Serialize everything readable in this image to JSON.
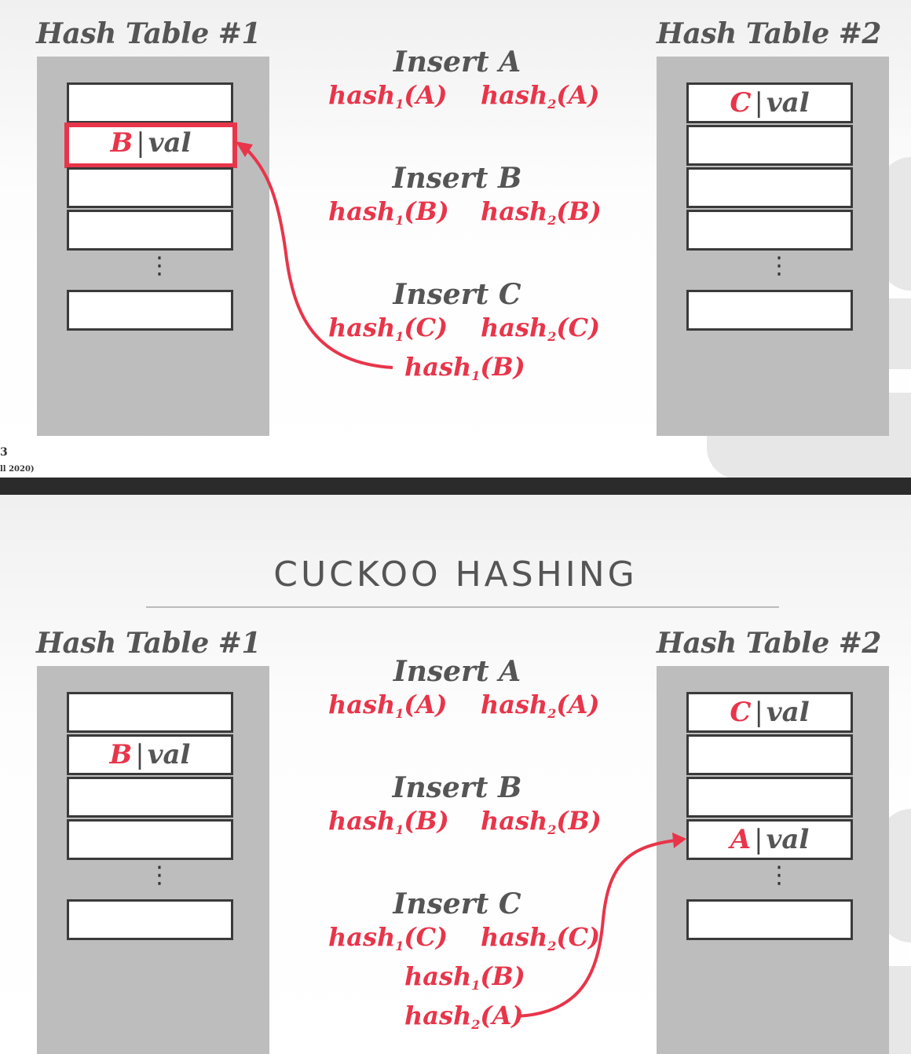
{
  "slide1": {
    "left_table": {
      "title": "Hash Table #1",
      "slots": [
        {
          "key": "",
          "val": ""
        },
        {
          "key": "B",
          "val": "val",
          "highlight": true
        },
        {
          "key": "",
          "val": ""
        },
        {
          "key": "",
          "val": ""
        },
        {
          "key": "",
          "val": ""
        }
      ]
    },
    "right_table": {
      "title": "Hash Table #2",
      "slots": [
        {
          "key": "C",
          "val": "val"
        },
        {
          "key": "",
          "val": ""
        },
        {
          "key": "",
          "val": ""
        },
        {
          "key": "",
          "val": ""
        },
        {
          "key": "",
          "val": ""
        }
      ]
    },
    "ops": [
      {
        "title": "Insert A",
        "calls": [
          {
            "fn": "hash",
            "n": "1",
            "arg": "(A)"
          },
          {
            "fn": "hash",
            "n": "2",
            "arg": "(A)"
          }
        ]
      },
      {
        "title": "Insert B",
        "calls": [
          {
            "fn": "hash",
            "n": "1",
            "arg": "(B)"
          },
          {
            "fn": "hash",
            "n": "2",
            "arg": "(B)"
          }
        ]
      },
      {
        "title": "Insert C",
        "calls": [
          {
            "fn": "hash",
            "n": "1",
            "arg": "(C)"
          },
          {
            "fn": "hash",
            "n": "2",
            "arg": "(C)"
          }
        ],
        "extra": [
          {
            "fn": "hash",
            "n": "1",
            "arg": "(B)"
          }
        ]
      }
    ],
    "footer": {
      "line1": "3",
      "line2": "ll 2020)"
    }
  },
  "slide2": {
    "title": "CUCKOO HASHING",
    "left_table": {
      "title": "Hash Table #1",
      "slots": [
        {
          "key": "",
          "val": ""
        },
        {
          "key": "B",
          "val": "val"
        },
        {
          "key": "",
          "val": ""
        },
        {
          "key": "",
          "val": ""
        },
        {
          "key": "",
          "val": ""
        }
      ]
    },
    "right_table": {
      "title": "Hash Table #2",
      "slots": [
        {
          "key": "C",
          "val": "val"
        },
        {
          "key": "",
          "val": ""
        },
        {
          "key": "",
          "val": ""
        },
        {
          "key": "A",
          "val": "val"
        },
        {
          "key": "",
          "val": ""
        }
      ]
    },
    "ops": [
      {
        "title": "Insert A",
        "calls": [
          {
            "fn": "hash",
            "n": "1",
            "arg": "(A)"
          },
          {
            "fn": "hash",
            "n": "2",
            "arg": "(A)"
          }
        ]
      },
      {
        "title": "Insert B",
        "calls": [
          {
            "fn": "hash",
            "n": "1",
            "arg": "(B)"
          },
          {
            "fn": "hash",
            "n": "2",
            "arg": "(B)"
          }
        ]
      },
      {
        "title": "Insert C",
        "calls": [
          {
            "fn": "hash",
            "n": "1",
            "arg": "(C)"
          },
          {
            "fn": "hash",
            "n": "2",
            "arg": "(C)"
          }
        ],
        "extra": [
          {
            "fn": "hash",
            "n": "1",
            "arg": "(B)"
          },
          {
            "fn": "hash",
            "n": "2",
            "arg": "(A)"
          }
        ]
      }
    ]
  },
  "dots_glyph": "⋮",
  "colors": {
    "accent": "#e8354a",
    "panel": "#bdbdbd",
    "text": "#555555",
    "separator": "#2b2b2b"
  }
}
